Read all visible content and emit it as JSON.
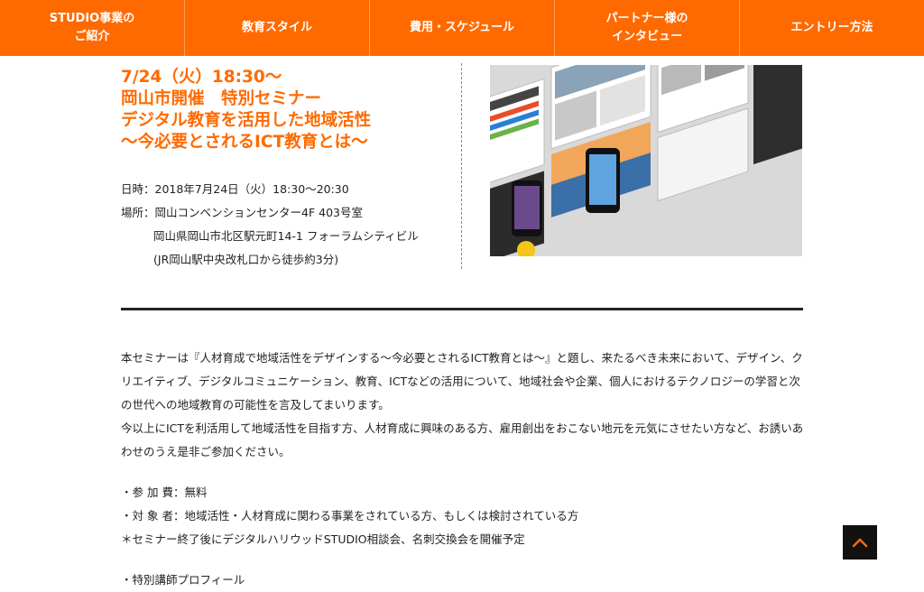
{
  "nav": {
    "items": [
      {
        "label": "STUDIO事業の\nご紹介"
      },
      {
        "label": "教育スタイル"
      },
      {
        "label": "費用・スケジュール"
      },
      {
        "label": "パートナー様の\nインタビュー"
      },
      {
        "label": "エントリー方法"
      }
    ]
  },
  "event": {
    "title": "7/24（火）18:30〜\n岡山市開催　特別セミナー\nデジタル教育を活用した地域活性\n〜今必要とされるICT教育とは〜",
    "date": "日時：2018年7月24日（火）18:30〜20:30",
    "venue": "場所：岡山コンベンションセンター4F 403号室",
    "address": "岡山県岡山市北区駅元町14-1 フォーラムシティビル",
    "access": "(JR岡山駅中央改札口から徒歩約3分)"
  },
  "description": {
    "paragraph1": "本セミナーは『人材育成で地域活性をデザインする〜今必要とされるICT教育とは〜』と題し、来たるべき未来において、デザイン、クリエイティブ、デジタルコミュニケーション、教育、ICTなどの活用について、地域社会や企業、個人におけるテクノロジーの学習と次の世代への地域教育の可能性を言及してまいります。",
    "paragraph2": "今以上にICTを利活用して地域活性を目指す方、人材育成に興味のある方、雇用創出をおこない地元を元気にさせたい方など、お誘いあわせのうえ是非ご参加ください。"
  },
  "details": {
    "fee": "・参 加 費：無料",
    "target": "・対 象 者：地域活性・人材育成に関わる事業をされている方、もしくは検討されている方",
    "note": "＊セミナー終了後にデジタルハリウッドSTUDIO相談会、名刺交換会を開催予定"
  },
  "profile": {
    "heading": "・特別講師プロフィール"
  },
  "colors": {
    "accent": "#ff6a00",
    "text": "#222222",
    "scroll_button": "#111111"
  },
  "icons": {
    "scroll_top": "chevron-up-icon"
  }
}
